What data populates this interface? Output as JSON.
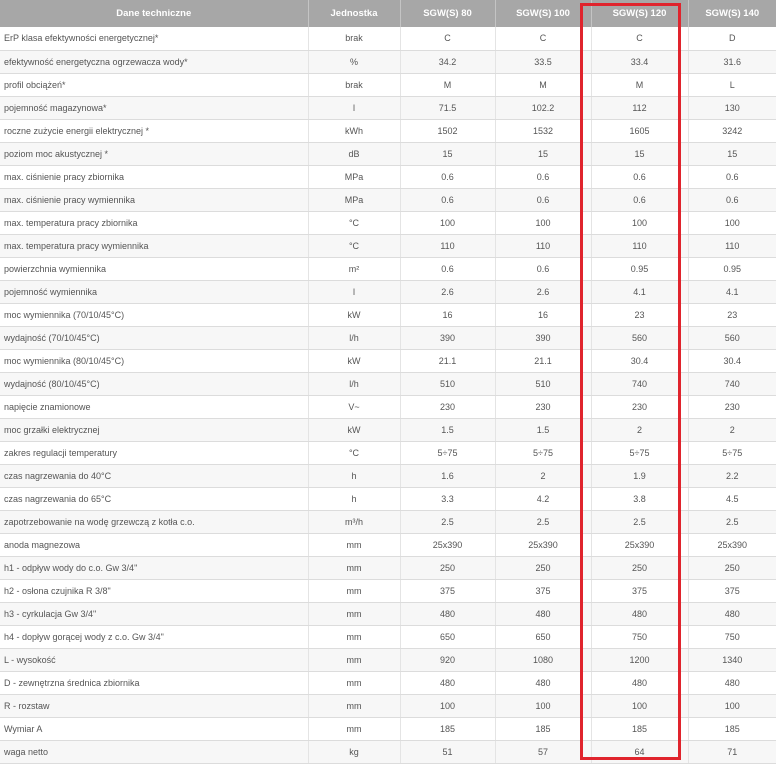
{
  "table": {
    "headers": [
      "Dane techniczne",
      "Jednostka",
      "SGW(S) 80",
      "SGW(S) 100",
      "SGW(S) 120",
      "SGW(S) 140"
    ],
    "rows": [
      [
        "ErP klasa efektywności energetycznej*",
        "brak",
        "C",
        "C",
        "C",
        "D"
      ],
      [
        "efektywność energetyczna ogrzewacza wody*",
        "%",
        "34.2",
        "33.5",
        "33.4",
        "31.6"
      ],
      [
        "profil obciążeń*",
        "brak",
        "M",
        "M",
        "M",
        "L"
      ],
      [
        "pojemność magazynowa*",
        "l",
        "71.5",
        "102.2",
        "112",
        "130"
      ],
      [
        "roczne zużycie energii elektrycznej *",
        "kWh",
        "1502",
        "1532",
        "1605",
        "3242"
      ],
      [
        "poziom moc akustycznej *",
        "dB",
        "15",
        "15",
        "15",
        "15"
      ],
      [
        "max. ciśnienie pracy zbiornika",
        "MPa",
        "0.6",
        "0.6",
        "0.6",
        "0.6"
      ],
      [
        "max. ciśnienie pracy wymiennika",
        "MPa",
        "0.6",
        "0.6",
        "0.6",
        "0.6"
      ],
      [
        "max. temperatura pracy zbiornika",
        "°C",
        "100",
        "100",
        "100",
        "100"
      ],
      [
        "max. temperatura pracy wymiennika",
        "°C",
        "110",
        "110",
        "110",
        "110"
      ],
      [
        "powierzchnia wymiennika",
        "m²",
        "0.6",
        "0.6",
        "0.95",
        "0.95"
      ],
      [
        "pojemność wymiennika",
        "l",
        "2.6",
        "2.6",
        "4.1",
        "4.1"
      ],
      [
        "moc wymiennika (70/10/45°C)",
        "kW",
        "16",
        "16",
        "23",
        "23"
      ],
      [
        "wydajność (70/10/45°C)",
        "l/h",
        "390",
        "390",
        "560",
        "560"
      ],
      [
        "moc wymiennika (80/10/45°C)",
        "kW",
        "21.1",
        "21.1",
        "30.4",
        "30.4"
      ],
      [
        "wydajność (80/10/45°C)",
        "l/h",
        "510",
        "510",
        "740",
        "740"
      ],
      [
        "napięcie znamionowe",
        "V~",
        "230",
        "230",
        "230",
        "230"
      ],
      [
        "moc grzałki elektrycznej",
        "kW",
        "1.5",
        "1.5",
        "2",
        "2"
      ],
      [
        "zakres regulacji temperatury",
        "°C",
        "5÷75",
        "5÷75",
        "5÷75",
        "5÷75"
      ],
      [
        "czas nagrzewania do 40°C",
        "h",
        "1.6",
        "2",
        "1.9",
        "2.2"
      ],
      [
        "czas nagrzewania do 65°C",
        "h",
        "3.3",
        "4.2",
        "3.8",
        "4.5"
      ],
      [
        "zapotrzebowanie na wodę grzewczą z kotła c.o.",
        "m³/h",
        "2.5",
        "2.5",
        "2.5",
        "2.5"
      ],
      [
        "anoda magnezowa",
        "mm",
        "25x390",
        "25x390",
        "25x390",
        "25x390"
      ],
      [
        "h1 - odpływ wody do c.o. Gw 3/4\"",
        "mm",
        "250",
        "250",
        "250",
        "250"
      ],
      [
        "h2 - osłona czujnika R 3/8\"",
        "mm",
        "375",
        "375",
        "375",
        "375"
      ],
      [
        "h3 - cyrkulacja Gw 3/4\"",
        "mm",
        "480",
        "480",
        "480",
        "480"
      ],
      [
        "h4 - dopływ gorącej wody z c.o. Gw 3/4\"",
        "mm",
        "650",
        "650",
        "750",
        "750"
      ],
      [
        "L - wysokość",
        "mm",
        "920",
        "1080",
        "1200",
        "1340"
      ],
      [
        "D - zewnętrzna średnica zbiornika",
        "mm",
        "480",
        "480",
        "480",
        "480"
      ],
      [
        "R - rozstaw",
        "mm",
        "100",
        "100",
        "100",
        "100"
      ],
      [
        "Wymiar A",
        "mm",
        "185",
        "185",
        "185",
        "185"
      ],
      [
        "waga netto",
        "kg",
        "51",
        "57",
        "64",
        "71"
      ]
    ]
  },
  "highlight": {
    "column": "SGW(S) 120",
    "color": "#e0242d"
  },
  "colors": {
    "header_bg": "#a7a7a7",
    "header_text": "#ffffff",
    "cell_text": "#555555",
    "row_alt_bg": "#f7f7f7"
  }
}
